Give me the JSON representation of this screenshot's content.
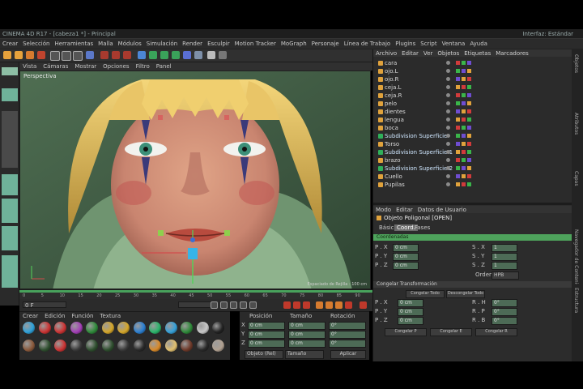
{
  "window": {
    "title": "CINEMA 4D R17 - [cabeza1 *] - Principal",
    "right_text": "Interfaz: Estándar"
  },
  "menubar": [
    "Crear",
    "Selección",
    "Herramientas",
    "Malla",
    "Módulos",
    "Simulación",
    "Render",
    "Esculpir",
    "Motion Tracker",
    "MoGraph",
    "Personaje",
    "Línea de Trabajo",
    "Plugins",
    "Script",
    "Ventana",
    "Ayuda"
  ],
  "viewport": {
    "header": [
      "Vista",
      "Cámaras",
      "Mostrar",
      "Opciones",
      "Filtro",
      "Panel"
    ],
    "label": "Perspectiva",
    "grid_label": "Espaciado de Rejilla : 100 cm"
  },
  "timeline": {
    "ticks": [
      "0",
      "5",
      "10",
      "15",
      "20",
      "25",
      "30",
      "35",
      "40",
      "45",
      "50",
      "55",
      "60",
      "65",
      "70",
      "75",
      "80",
      "85",
      "90"
    ],
    "frame": "0 F"
  },
  "materials": {
    "menu": [
      "Crear",
      "Edición",
      "Función",
      "Textura"
    ]
  },
  "coords": {
    "headers": [
      "Posición",
      "Tamaño",
      "Rotación"
    ],
    "rows": [
      {
        "axis": "X",
        "pos": "0 cm",
        "size": "0 cm",
        "rot": "0°"
      },
      {
        "axis": "Y",
        "pos": "0 cm",
        "size": "0 cm",
        "rot": "0°"
      },
      {
        "axis": "Z",
        "pos": "0 cm",
        "size": "0 cm",
        "rot": "0°"
      }
    ],
    "mode": "Objeto (Rel)",
    "size_mode": "Tamaño",
    "apply": "Aplicar"
  },
  "objects_panel": {
    "tabs": [
      "Archivo",
      "Editar",
      "Ver",
      "Objetos",
      "Etiquetas",
      "Marcadores"
    ],
    "items": [
      "cara",
      "ojo.L",
      "ojo.R",
      "ceja.L",
      "ceja.R",
      "pelo",
      "dientes",
      "lengua",
      "boca",
      "Subdivision Superficie",
      "Torso",
      "Subdivision Superficie.1",
      "brazo",
      "Subdivision Superficie.2",
      "Cuello",
      "Pupilas"
    ]
  },
  "attributes_panel": {
    "tabs": [
      "Modo",
      "Editar",
      "Datos de Usuario"
    ],
    "title": "Objeto Poligonal [OPEN]",
    "subtabs": [
      "Básico",
      "Coord.",
      "Fases"
    ],
    "section": "Coordenadas",
    "rows": [
      {
        "label": "P . X",
        "value": "0 cm",
        "label2": "S . X",
        "value2": "1"
      },
      {
        "label": "P . Y",
        "value": "0 cm",
        "label2": "S . Y",
        "value2": "1"
      },
      {
        "label": "P . Z",
        "value": "0 cm",
        "label2": "S . Z",
        "value2": "1"
      }
    ],
    "order": "Orden",
    "order_value": "HPB",
    "section2": "Congelar Transformación",
    "buttons": [
      "Congelar Todo",
      "Descongelar Todo"
    ],
    "rows2": [
      {
        "label": "P . X",
        "value": "0 cm",
        "label2": "R . H",
        "value2": "0°"
      },
      {
        "label": "P . Y",
        "value": "0 cm",
        "label2": "R . P",
        "value2": "0°"
      },
      {
        "label": "P . Z",
        "value": "0 cm",
        "label2": "R . B",
        "value2": "0°"
      }
    ],
    "buttons2": [
      "Congelar P",
      "Congelar E",
      "Congelar R"
    ]
  },
  "right_sidebar": [
    "Objetos",
    "Atributos",
    "Capas",
    "Navegador de Contenido",
    "Estructura"
  ],
  "colors": {
    "accent_green": "#4ea35c",
    "panel_bg": "#2c2c2c",
    "viewport_bg": "#3e5b43"
  }
}
